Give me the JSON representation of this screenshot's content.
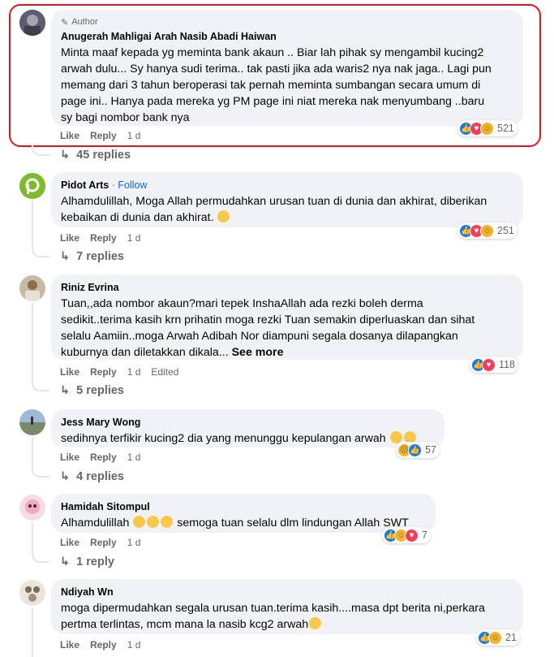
{
  "author_badge": "Author",
  "see_more": "See more",
  "actions": {
    "like": "Like",
    "reply": "Reply",
    "edited": "Edited"
  },
  "comments": [
    {
      "name": "Anugerah Mahligai Arah Nasib Abadi Haiwan",
      "text": "Minta maaf kepada yg meminta bank akaun .. Biar lah pihak sy mengambil kucing2\narwah dulu... Sy hanya sudi terima.. tak pasti jika ada waris2 nya nak jaga.. Lagi pun\nmemang dari 3 tahun beroperasi tak pernah meminta sumbangan secara umum di\npage ini.. Hanya pada mereka yg PM page ini niat mereka nak menyumbang ..baru\nsy bagi nombor bank nya",
      "time": "1 d",
      "reaction_count": "521",
      "replies": "45 replies"
    },
    {
      "name": "Pidot Arts",
      "follow": "Follow",
      "text": "Alhamdulillah, Moga Allah permudahkan urusan tuan di dunia dan akhirat, diberikan\nkebaikan di dunia dan akhirat.",
      "time": "1 d",
      "reaction_count": "251",
      "replies": "7 replies"
    },
    {
      "name": "Riniz Evrina",
      "text": "Tuan,,ada nombor akaun?mari tepek InshaAllah ada rezki boleh derma\nsedikit..terima kasih krn prihatin moga rezki Tuan semakin diperluaskan dan sihat\nselalu Aamiin..moga Arwah Adibah Nor diampuni segala dosanya dilapangkan\nkuburnya dan diletakkan dikala...",
      "time": "1 d",
      "reaction_count": "118",
      "replies": "5 replies"
    },
    {
      "name": "Jess Mary Wong",
      "text": "sedihnya terfikir kucing2 dia yang menunggu kepulangan arwah",
      "time": "1 d",
      "reaction_count": "57",
      "replies": "4 replies"
    },
    {
      "name": "Hamidah Sitompul",
      "text_before": "Alhamdulillah",
      "text_after": "semoga tuan selalu dlm lindungan Allah SWT",
      "time": "1 d",
      "reaction_count": "7",
      "replies": "1 reply"
    },
    {
      "name": "Ndiyah Wn",
      "text": "moga dipermudahkan segala urusan tuan.terima kasih....masa dpt berita ni,perkara\npertma terlintas, mcm mana la nasib kcg2 arwah",
      "time": "1 d",
      "reaction_count": "21"
    }
  ]
}
